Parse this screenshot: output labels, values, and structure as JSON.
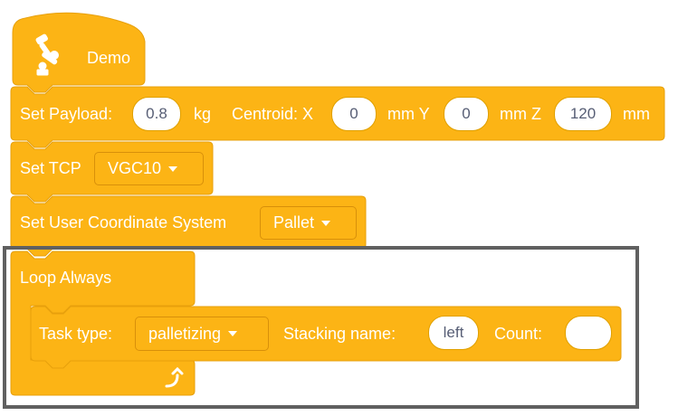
{
  "hat": {
    "label": "Demo",
    "icon": "robot-arm-icon"
  },
  "payload": {
    "label": "Set Payload:",
    "value": "0.8",
    "unit": "kg",
    "centroid_label": "Centroid: X",
    "x": "0",
    "y_label": "mm Y",
    "y": "0",
    "z_label": "mm Z",
    "z": "120",
    "end_unit": "mm"
  },
  "tcp": {
    "label": "Set TCP",
    "selected": "VGC10"
  },
  "user_coord": {
    "label": "Set User Coordinate System",
    "selected": "Pallet"
  },
  "loop": {
    "label": "Loop Always",
    "icon": "loop-arrow-icon"
  },
  "task": {
    "type_label": "Task type:",
    "type_selected": "palletizing",
    "stacking_label": "Stacking name:",
    "stacking_value": "left",
    "count_label": "Count:",
    "count_value": ""
  },
  "colors": {
    "block_fill": "#fcb415",
    "block_stroke": "#e7a00c",
    "selection_frame": "#606060"
  }
}
